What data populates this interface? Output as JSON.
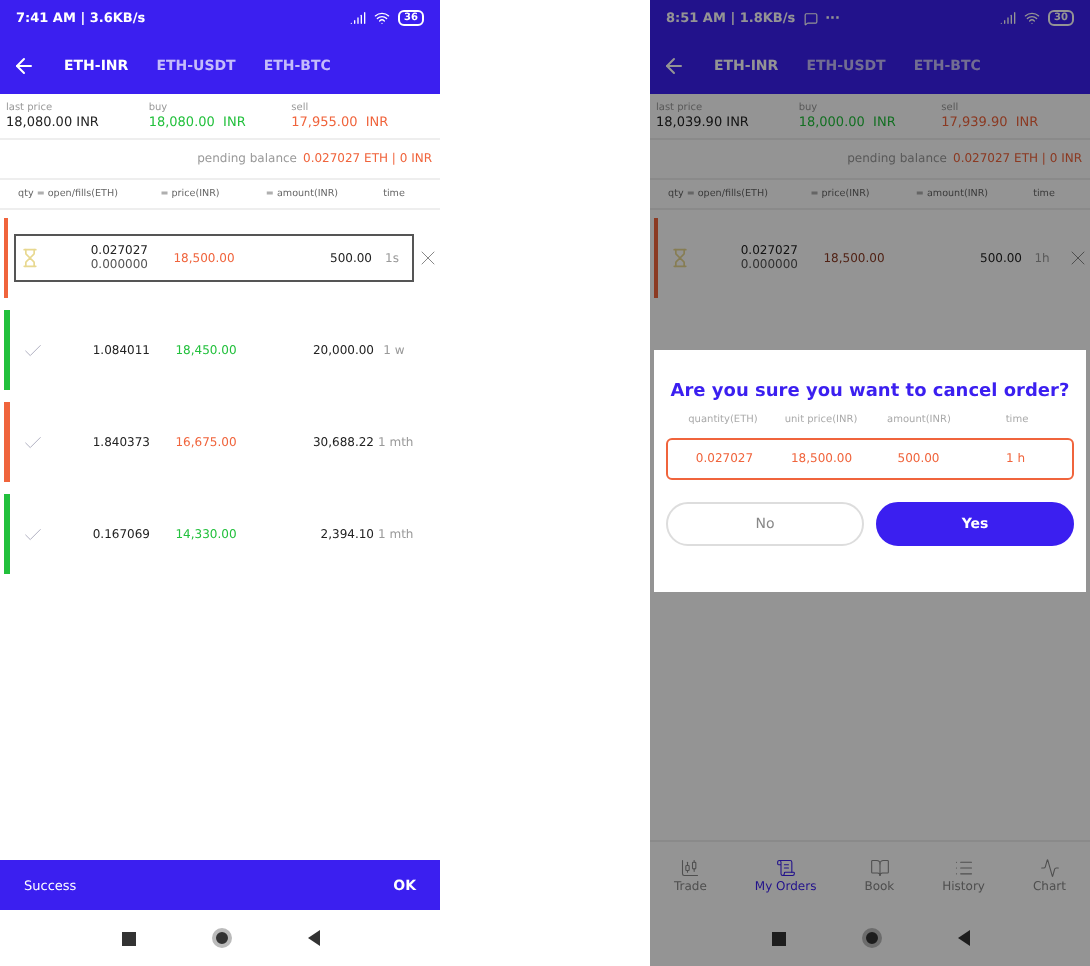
{
  "screens": [
    {
      "status": {
        "time": "7:41 AM | 3.6KB/s",
        "battery": "36"
      },
      "tabs": [
        {
          "label": "ETH-INR",
          "selected": true
        },
        {
          "label": "ETH-USDT",
          "selected": false
        },
        {
          "label": "ETH-BTC",
          "selected": false
        }
      ],
      "prices": [
        {
          "kind": "last",
          "label": "last price",
          "value": "18,080.00 INR"
        },
        {
          "kind": "buy",
          "label": "buy",
          "value": "18,080.00  INR"
        },
        {
          "kind": "sell",
          "label": "sell",
          "value": "17,955.00  INR"
        }
      ],
      "pending": {
        "label": "pending balance",
        "value": "0.027027 ETH | 0 INR"
      },
      "columns": [
        "qty = open/fills(ETH)",
        "= price(INR)",
        "= amount(INR)",
        "time"
      ],
      "orders": [
        {
          "color": "#f0643c",
          "kind": "pending",
          "selected": true,
          "qty": "0.027027",
          "fills": "0.000000",
          "price": "18,500.00",
          "amount": "500.00",
          "time": "1s"
        },
        {
          "color": "#22c03c",
          "kind": "done",
          "selected": false,
          "qty": "1.084011",
          "price": "18,450.00",
          "amount": "20,000.00",
          "time": "1 w"
        },
        {
          "color": "#f0643c",
          "kind": "done",
          "selected": false,
          "qty": "1.840373",
          "price": "16,675.00",
          "amount": "30,688.22",
          "time": "1 mth"
        },
        {
          "color": "#22c03c",
          "kind": "done",
          "selected": false,
          "qty": "0.167069",
          "price": "14,330.00",
          "amount": "2,394.10",
          "time": "1 mth"
        }
      ],
      "snackbar": {
        "message": "Success",
        "action": "OK"
      }
    },
    {
      "status": {
        "time": "8:51 AM | 1.8KB/s",
        "message_icon": true,
        "dots": "···",
        "battery": "30"
      },
      "tabs": [
        {
          "label": "ETH-INR",
          "selected": true
        },
        {
          "label": "ETH-USDT",
          "selected": false
        },
        {
          "label": "ETH-BTC",
          "selected": false
        }
      ],
      "prices": [
        {
          "kind": "last",
          "label": "last price",
          "value": "18,039.90 INR"
        },
        {
          "kind": "buy",
          "label": "buy",
          "value": "18,000.00  INR"
        },
        {
          "kind": "sell",
          "label": "sell",
          "value": "17,939.90  INR"
        }
      ],
      "pending": {
        "label": "pending balance",
        "value": "0.027027 ETH | 0 INR"
      },
      "columns": [
        "qty = open/fills(ETH)",
        "= price(INR)",
        "= amount(INR)",
        "time"
      ],
      "orders": [
        {
          "color": "#8b3a23",
          "kind": "pending",
          "selected": false,
          "qty": "0.027027",
          "fills": "0.000000",
          "price": "18,500.00",
          "amount": "500.00",
          "time": "1h"
        }
      ],
      "bottom_tabs": [
        {
          "kind": "trade",
          "label": "Trade",
          "selected": false
        },
        {
          "kind": "orders",
          "label": "My Orders",
          "selected": true
        },
        {
          "kind": "book",
          "label": "Book",
          "selected": false
        },
        {
          "kind": "history",
          "label": "History",
          "selected": false
        },
        {
          "kind": "chart",
          "label": "Chart",
          "selected": false
        }
      ],
      "dialog": {
        "title": "Are you sure you want to cancel order?",
        "columns": [
          "quantity(ETH)",
          "unit price(INR)",
          "amount(INR)",
          "time"
        ],
        "values": [
          "0.027027",
          "18,500.00",
          "500.00",
          "1 h"
        ],
        "buttons": [
          {
            "kind": "secondary",
            "label": "No"
          },
          {
            "kind": "primary",
            "label": "Yes"
          }
        ]
      }
    }
  ]
}
